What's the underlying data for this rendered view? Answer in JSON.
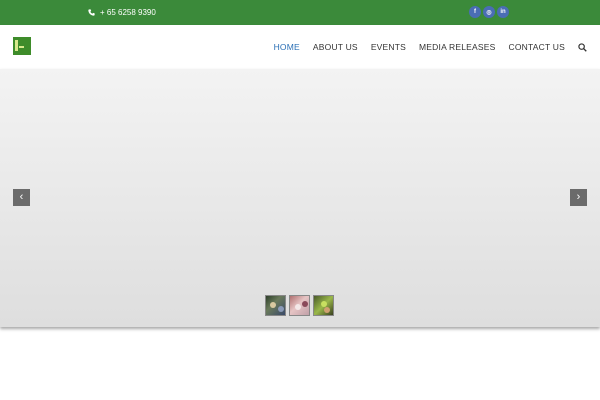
{
  "topbar": {
    "phone": "+ 65 6258 9390",
    "socials": [
      {
        "icon": "facebook-icon",
        "glyph": "f"
      },
      {
        "icon": "instagram-icon",
        "glyph": "◎"
      },
      {
        "icon": "linkedin-icon",
        "glyph": "in"
      }
    ]
  },
  "nav": {
    "items": [
      {
        "label": "HOME",
        "active": true
      },
      {
        "label": "ABOUT US",
        "active": false
      },
      {
        "label": "EVENTS",
        "active": false
      },
      {
        "label": "MEDIA RELEASES",
        "active": false
      },
      {
        "label": "CONTACT US",
        "active": false
      }
    ],
    "search_icon": "search-icon"
  },
  "slider": {
    "prev_glyph": "‹",
    "next_glyph": "›",
    "thumbnails": 3
  },
  "colors": {
    "topbar": "#3b8a3a",
    "accent": "#2a6fb5",
    "social": "#4a6db5"
  }
}
